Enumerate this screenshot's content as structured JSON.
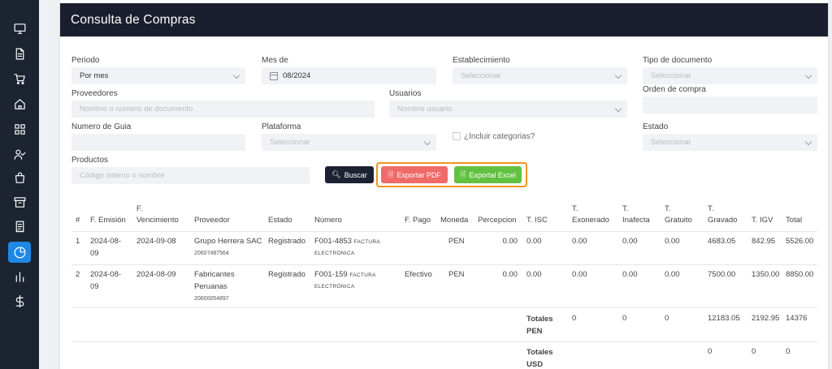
{
  "sidebar": {
    "items": [
      {
        "icon": "monitor-icon"
      },
      {
        "icon": "document-icon"
      },
      {
        "icon": "cart-icon"
      },
      {
        "icon": "home-icon"
      },
      {
        "icon": "grid-icon"
      },
      {
        "icon": "user-check-icon"
      },
      {
        "icon": "shopping-bag-icon"
      },
      {
        "icon": "archive-icon"
      },
      {
        "icon": "receipt-icon"
      },
      {
        "icon": "pie-chart-icon",
        "active": true
      },
      {
        "icon": "bar-chart-icon"
      },
      {
        "icon": "dollar-icon"
      }
    ],
    "active_color": "#1e88e5"
  },
  "page": {
    "title": "Consulta de Compras"
  },
  "filters": {
    "periodo": {
      "label": "Periodo",
      "value": "Por mes"
    },
    "mes_de": {
      "label": "Mes de",
      "value": "08/2024"
    },
    "establecimiento": {
      "label": "Establecimiento",
      "placeholder": "Seleccionar"
    },
    "tipo_documento": {
      "label": "Tipo de documento",
      "placeholder": "Seleccionar"
    },
    "proveedores": {
      "label": "Proveedores",
      "placeholder": "Nombre o número de documento"
    },
    "usuarios": {
      "label": "Usuarios",
      "placeholder": "Nombre usuario"
    },
    "orden_compra": {
      "label": "Orden de compra",
      "value": ""
    },
    "numero_guia": {
      "label": "Numero de Guia",
      "value": ""
    },
    "plataforma": {
      "label": "Plataforma",
      "placeholder": "Seleccionar"
    },
    "incluir_categorias": {
      "label": "¿Incluir categorias?",
      "checked": false
    },
    "estado": {
      "label": "Estado",
      "placeholder": "Seleccionar"
    },
    "productos": {
      "label": "Productos",
      "placeholder": "Código interno o nombre"
    }
  },
  "buttons": {
    "search": "Buscar",
    "export_pdf": "Exportar PDF",
    "export_excel": "Exportal Excel",
    "pdf_color": "#ef6a68",
    "excel_color": "#62c140",
    "highlight_color": "#f0941f"
  },
  "table": {
    "headers": {
      "num": "#",
      "f_emision": "F. Emisión",
      "f_venc_1": "F.",
      "f_venc_2": "Vencimiento",
      "proveedor": "Proveedor",
      "estado": "Estado",
      "numero": "Número",
      "f_pago": "F. Pago",
      "moneda": "Moneda",
      "percepcion": "Percepcion",
      "t_isc": "T. ISC",
      "t_exo_1": "T.",
      "t_exo_2": "Exonerado",
      "t_ina_1": "T.",
      "t_ina_2": "Inafecta",
      "t_gra_1": "T.",
      "t_gra_2": "Gratuito",
      "t_grav_1": "T.",
      "t_grav_2": "Gravado",
      "t_igv": "T. IGV",
      "total": "Total"
    },
    "rows": [
      {
        "num": "1",
        "f_emision_1": "2024-08-",
        "f_emision_2": "09",
        "f_vencimiento": "2024-09-08",
        "proveedor_1": "Grupo Herrera SAC",
        "proveedor_2": "",
        "proveedor_doc": "20607487564",
        "estado": "Registrado",
        "numero": "F001-4853",
        "tipo_1": "FACTURA",
        "tipo_2": "ELECTRÓNICA",
        "f_pago": "",
        "moneda": "PEN",
        "percepcion": "0.00",
        "t_isc": "0.00",
        "t_exonerado": "0.00",
        "t_inafecta": "0.00",
        "t_gratuito": "0.00",
        "t_gravado": "4683.05",
        "t_igv": "842.95",
        "total": "5526.00"
      },
      {
        "num": "2",
        "f_emision_1": "2024-08-",
        "f_emision_2": "09",
        "f_vencimiento": "2024-08-09",
        "proveedor_1": "Fabricantes",
        "proveedor_2": "Peruanas",
        "proveedor_doc": "20600054897",
        "estado": "Registrado",
        "numero": "F001-159",
        "tipo_1": "FACTURA",
        "tipo_2": "ELECTRÓNICA",
        "f_pago": "Efectivo",
        "moneda": "PEN",
        "percepcion": "0.00",
        "t_isc": "0.00",
        "t_exonerado": "0.00",
        "t_inafecta": "0.00",
        "t_gratuito": "0.00",
        "t_gravado": "7500.00",
        "t_igv": "1350.00",
        "total": "8850.00"
      }
    ],
    "totals_pen": {
      "label_1": "Totales",
      "label_2": "PEN",
      "t_exonerado": "0",
      "t_inafecta": "0",
      "t_gratuito": "0",
      "t_gravado": "12183.05",
      "t_igv": "2192.95",
      "total": "14376"
    },
    "totals_usd": {
      "label_1": "Totales",
      "label_2": "USD",
      "t_gravado": "0",
      "t_igv": "0",
      "total": "0"
    }
  }
}
